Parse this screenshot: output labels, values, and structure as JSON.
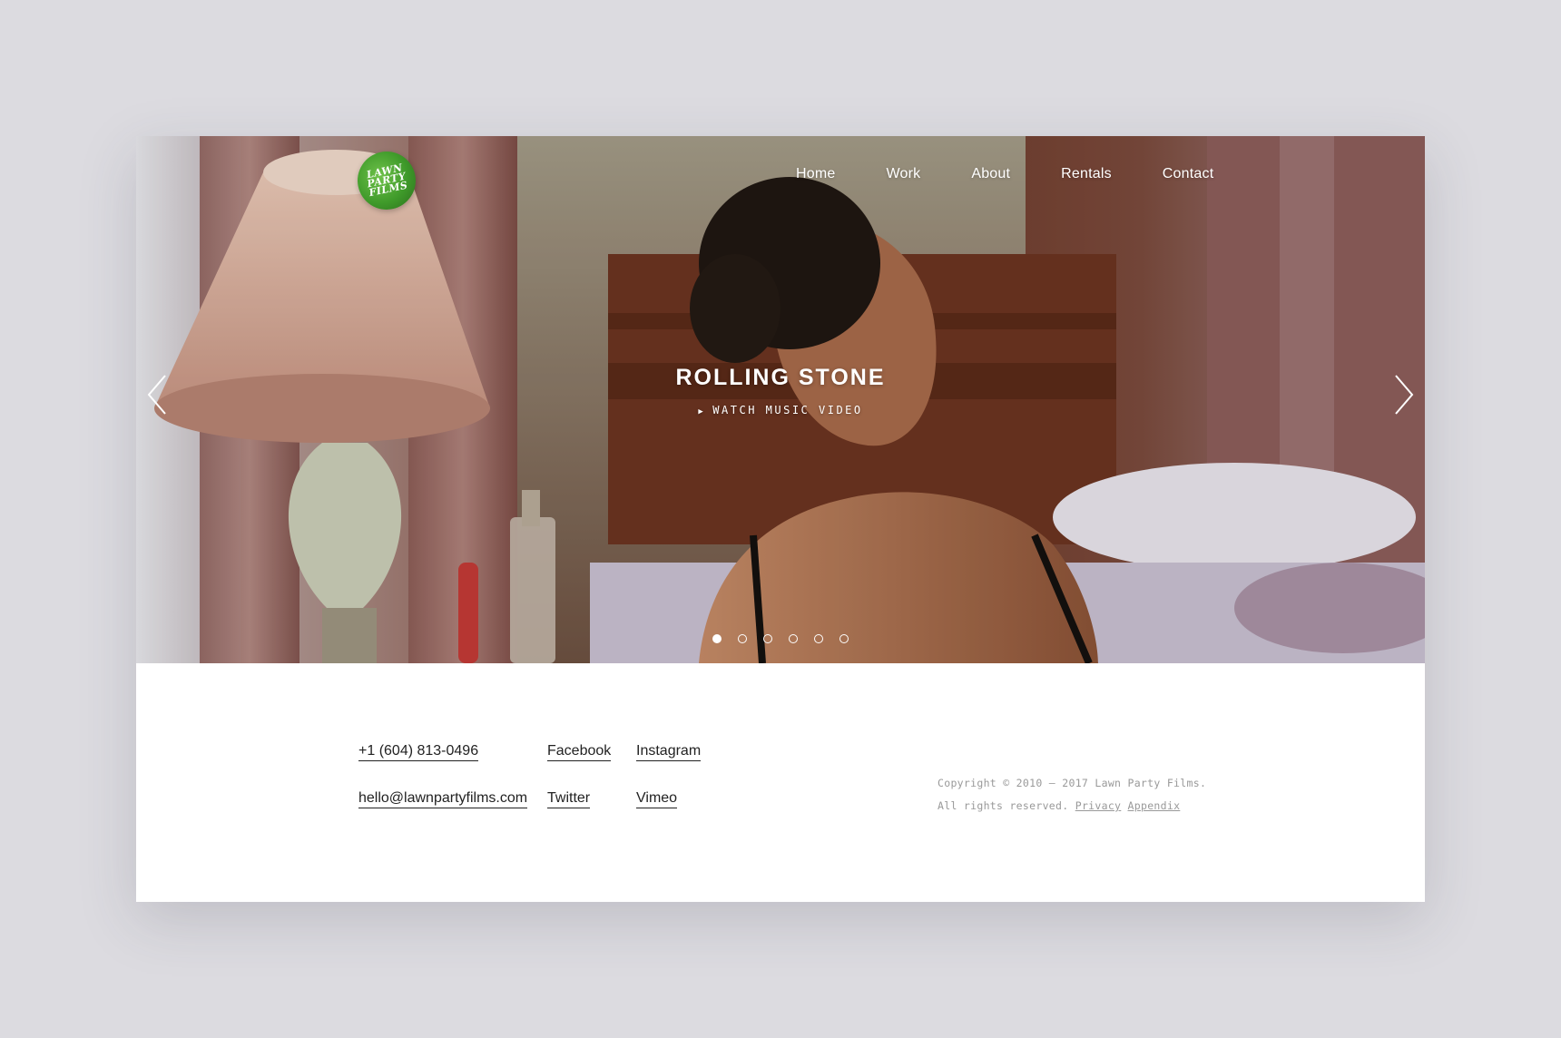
{
  "brand": {
    "logo_lines": [
      "LAWN",
      "PARTY",
      "FILMS"
    ]
  },
  "nav": {
    "items": [
      {
        "label": "Home"
      },
      {
        "label": "Work"
      },
      {
        "label": "About"
      },
      {
        "label": "Rentals"
      },
      {
        "label": "Contact"
      }
    ]
  },
  "hero": {
    "title": "ROLLING STONE",
    "cta_label": "WATCH MUSIC VIDEO",
    "cta_icon": "play-icon",
    "prev_icon": "chevron-left-icon",
    "next_icon": "chevron-right-icon",
    "slides_total": 6,
    "active_slide": 1
  },
  "footer": {
    "phone": "+1 (604) 813-0496",
    "email": "hello@lawnpartyfilms.com",
    "social": {
      "facebook": "Facebook",
      "instagram": "Instagram",
      "twitter": "Twitter",
      "vimeo": "Vimeo"
    },
    "copyright_line1": "Copyright © 2010 – 2017 Lawn Party Films.",
    "copyright_line2": "All rights reserved.",
    "privacy_label": "Privacy",
    "appendix_label": "Appendix"
  },
  "colors": {
    "page_background": "#dcdbe0",
    "logo_green": "#3f9a2a",
    "text_dark": "#222222",
    "text_muted": "#999999"
  }
}
